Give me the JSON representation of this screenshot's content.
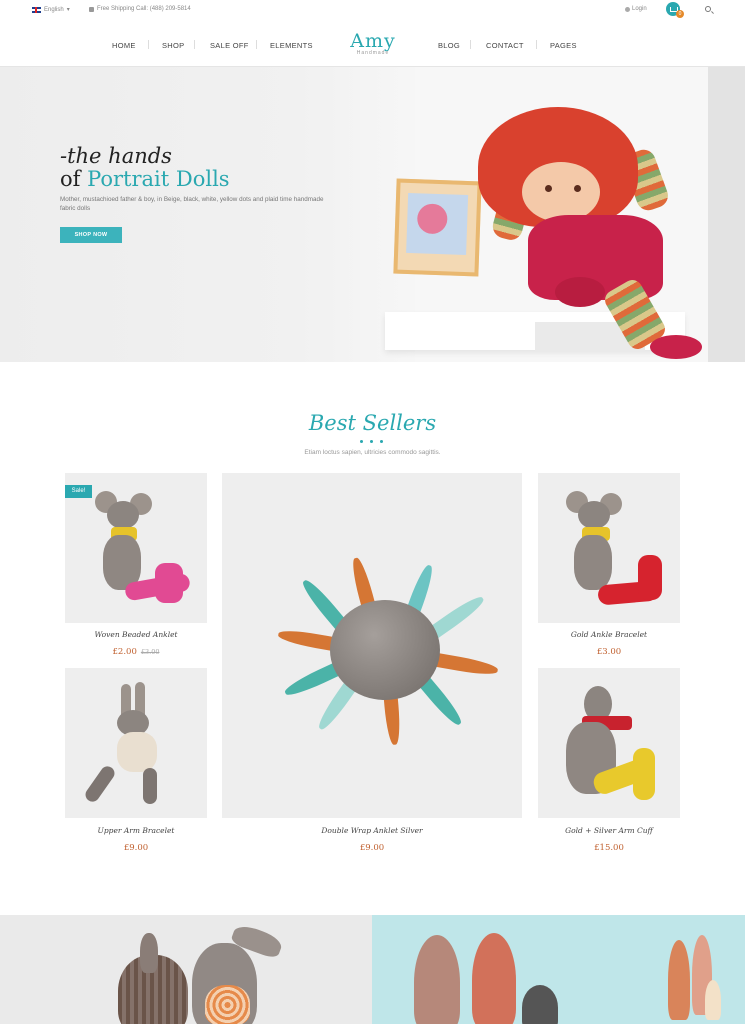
{
  "topbar": {
    "language": "English",
    "shipping": "Free Shipping Call: (488) 209-5814",
    "login": "Login",
    "cart_count": "0"
  },
  "nav": {
    "items": [
      "HOME",
      "SHOP",
      "SALE OFF",
      "ELEMENTS",
      "BLOG",
      "CONTACT",
      "PAGES"
    ],
    "logo": "Amy",
    "logo_sub": "Handmade"
  },
  "hero": {
    "title_line1": "-the hands",
    "title_line2_prefix": "of ",
    "title_line2_accent": "Portrait Dolls",
    "description": "Mother, mustachioed father & boy, in Beige, black, white, yellow dots and plaid time handmade fabric dolls",
    "button": "SHOP NOW"
  },
  "best_sellers": {
    "title": "Best Sellers",
    "subtitle": "Etiam loctus sapien, ultricies commodo sagittis.",
    "products": [
      {
        "name": "Woven Beaded Anklet",
        "price": "£2.00",
        "old_price": "£3.00",
        "badge": "Sale!"
      },
      {
        "name": "Gold Ankle Bracelet",
        "price": "£3.00"
      },
      {
        "name": "Upper Arm Bracelet",
        "price": "£9.00"
      },
      {
        "name": "Double Wrap Anklet Silver",
        "price": "£9.00"
      },
      {
        "name": "Gold + Silver Arm Cuff",
        "price": "£15.00"
      }
    ]
  },
  "colors": {
    "accent": "#2aa8b0",
    "price": "#c0602f",
    "cart_badge": "#e58a2b"
  },
  "icons": [
    "flag-uk-icon",
    "phone-icon",
    "user-icon",
    "cart-icon",
    "search-icon"
  ]
}
